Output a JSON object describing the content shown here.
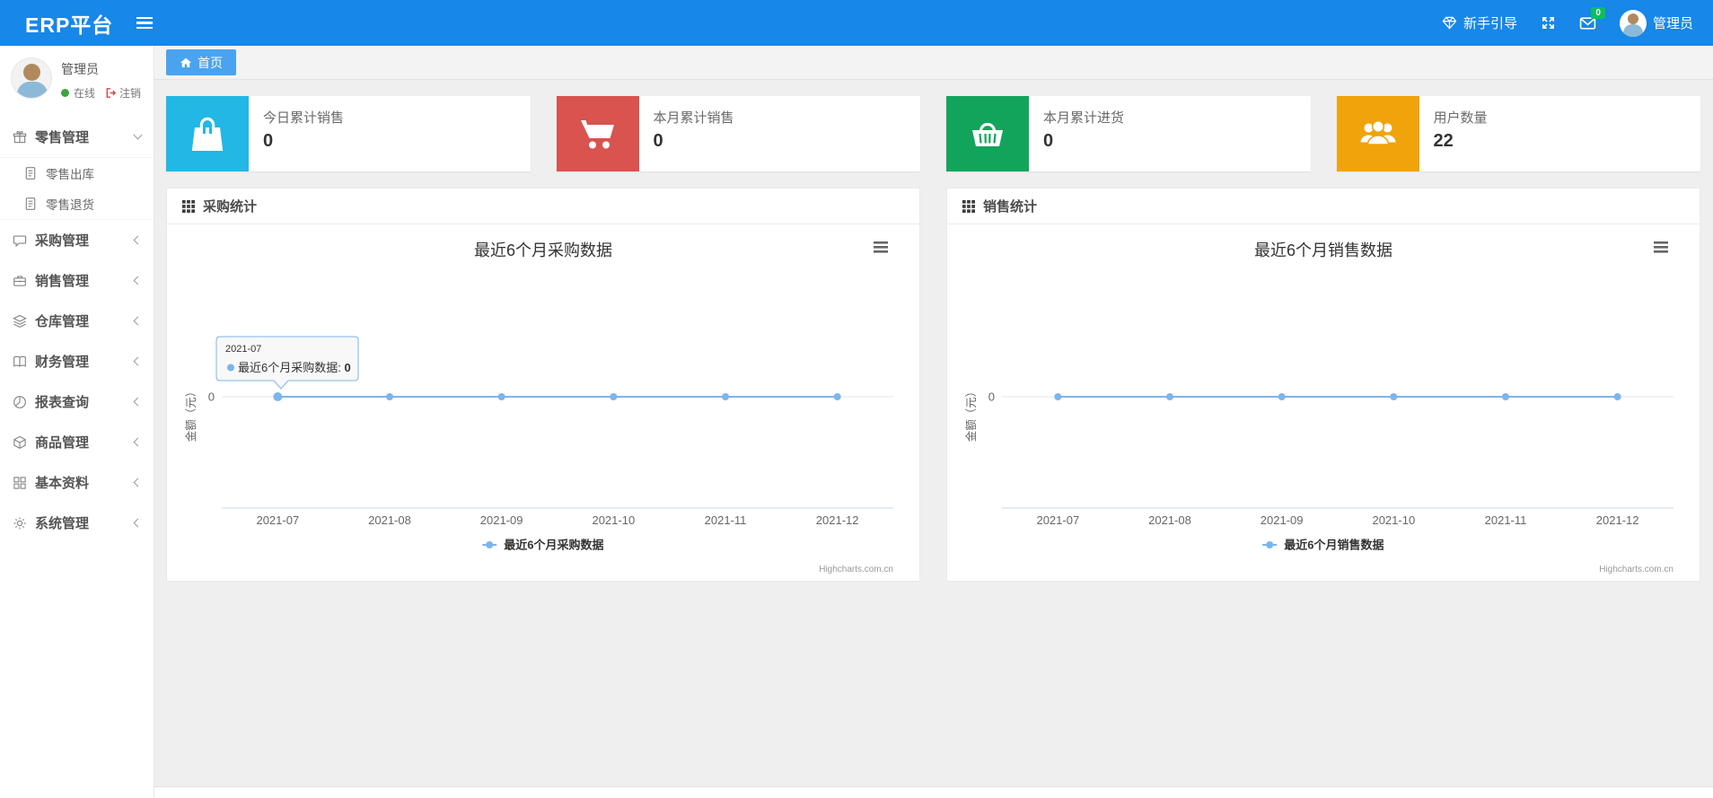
{
  "navbar": {
    "brand": "ERP平台",
    "guide_label": "新手引导",
    "message_badge": "0",
    "user_label": "管理员"
  },
  "sidebar": {
    "user": {
      "name": "管理员",
      "status": "在线",
      "logout": "注销"
    },
    "menu": [
      {
        "label": "零售管理",
        "icon": "gift-icon",
        "expanded": true,
        "children": [
          {
            "label": "零售出库",
            "icon": "doc-icon"
          },
          {
            "label": "零售退货",
            "icon": "doc-icon"
          }
        ]
      },
      {
        "label": "采购管理",
        "icon": "comment-icon"
      },
      {
        "label": "销售管理",
        "icon": "briefcase-icon"
      },
      {
        "label": "仓库管理",
        "icon": "layers-icon"
      },
      {
        "label": "财务管理",
        "icon": "book-icon"
      },
      {
        "label": "报表查询",
        "icon": "pie-chart-icon"
      },
      {
        "label": "商品管理",
        "icon": "box-icon"
      },
      {
        "label": "基本资料",
        "icon": "grid-icon"
      },
      {
        "label": "系统管理",
        "icon": "gear-icon"
      }
    ]
  },
  "breadcrumb": {
    "home": "首页"
  },
  "stat_cards": [
    {
      "label": "今日累计销售",
      "value": "0",
      "color": "#23b7e5",
      "icon": "shopping-bag-icon"
    },
    {
      "label": "本月累计销售",
      "value": "0",
      "color": "#d9534f",
      "icon": "cart-icon"
    },
    {
      "label": "本月累计进货",
      "value": "0",
      "color": "#13a45c",
      "icon": "basket-icon"
    },
    {
      "label": "用户数量",
      "value": "22",
      "color": "#f0a30a",
      "icon": "users-icon"
    }
  ],
  "chart_data": [
    {
      "type": "line",
      "panel_title": "采购统计",
      "title": "最近6个月采购数据",
      "categories": [
        "2021-07",
        "2021-08",
        "2021-09",
        "2021-10",
        "2021-11",
        "2021-12"
      ],
      "series": [
        {
          "name": "最近6个月采购数据",
          "values": [
            0,
            0,
            0,
            0,
            0,
            0
          ]
        }
      ],
      "ylabel": "金额（元）",
      "yticks": [
        "0"
      ],
      "line_color": "#7cb5ec",
      "grid": true,
      "legend_position": "bottom",
      "credit": "Highcharts.com.cn",
      "tooltip": {
        "category": "2021-07",
        "series": "最近6个月采购数据",
        "value": "0"
      }
    },
    {
      "type": "line",
      "panel_title": "销售统计",
      "title": "最近6个月销售数据",
      "categories": [
        "2021-07",
        "2021-08",
        "2021-09",
        "2021-10",
        "2021-11",
        "2021-12"
      ],
      "series": [
        {
          "name": "最近6个月销售数据",
          "values": [
            0,
            0,
            0,
            0,
            0,
            0
          ]
        }
      ],
      "ylabel": "金额（元）",
      "yticks": [
        "0"
      ],
      "line_color": "#7cb5ec",
      "grid": true,
      "legend_position": "bottom",
      "credit": "Highcharts.com.cn"
    }
  ]
}
